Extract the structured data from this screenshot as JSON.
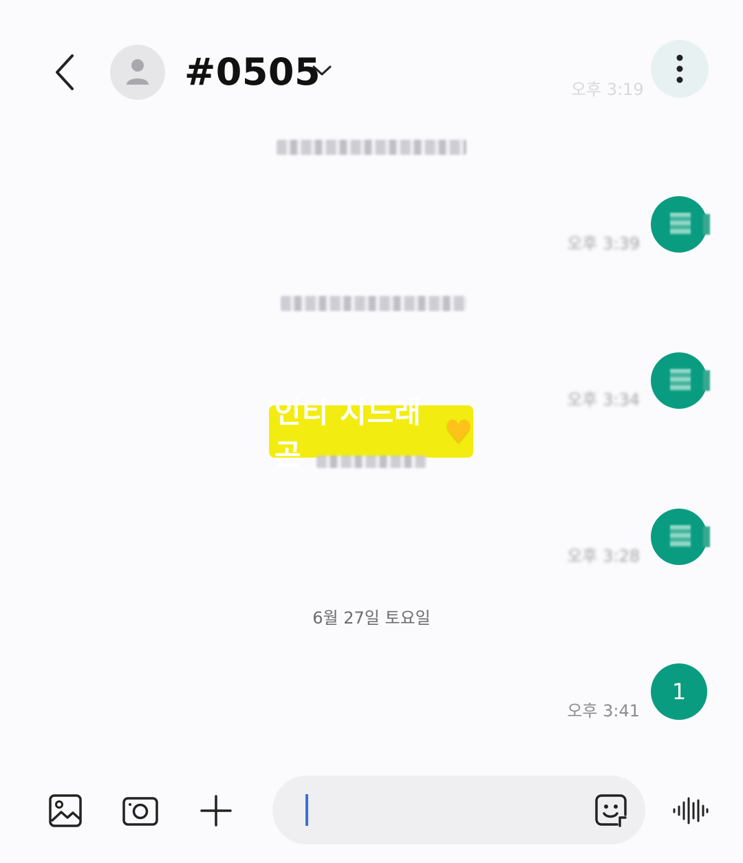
{
  "header": {
    "title": "#0505",
    "time_hint": "오후 3:19"
  },
  "sections": [
    {
      "date_label": "6월 27일 토요일"
    }
  ],
  "highlight": {
    "text": "인티 지드래곤"
  },
  "messages": [
    {
      "text": "1",
      "time": "오후 3:41"
    }
  ],
  "colors": {
    "accent": "#0a9c81",
    "highlight": "#f3ec11",
    "caret": "#3a6fd8"
  },
  "icons": {
    "back": "chevron-left-icon",
    "contact": "person-icon",
    "dropdown": "chevron-down-icon",
    "more": "more-vertical-icon",
    "gallery": "image-icon",
    "camera": "camera-icon",
    "add": "plus-icon",
    "sticker": "sticker-icon",
    "voice": "voice-wave-icon"
  }
}
